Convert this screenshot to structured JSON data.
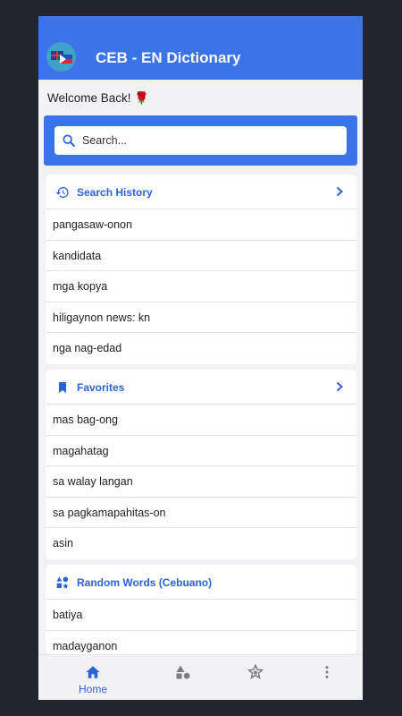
{
  "app": {
    "title": "CEB - EN Dictionary",
    "logo_icon": "uk-ph-flags-logo",
    "welcome": "Welcome Back! 🌹",
    "accent_color": "#3b73e8"
  },
  "search": {
    "placeholder": "Search...",
    "icon": "search-icon"
  },
  "history": {
    "title": "Search History",
    "icon": "history-icon",
    "items": [
      "pangasaw-onon",
      "kandidata",
      "mga kopya",
      "hiligaynon news: kn",
      "nga nag-edad"
    ]
  },
  "favorites": {
    "title": "Favorites",
    "icon": "bookmark-icon",
    "items": [
      "mas bag-ong",
      "magahatag",
      "sa walay langan",
      "sa pagkamapahitas-on",
      "asin"
    ]
  },
  "random": {
    "title": "Random Words (Cebuano)",
    "icon": "shapes-icon",
    "items": [
      "batiya",
      "madayganon"
    ]
  },
  "nav": {
    "home_label": "Home",
    "items": [
      "home-icon",
      "shapes-icon",
      "star-icon",
      "more-vert-icon"
    ]
  }
}
